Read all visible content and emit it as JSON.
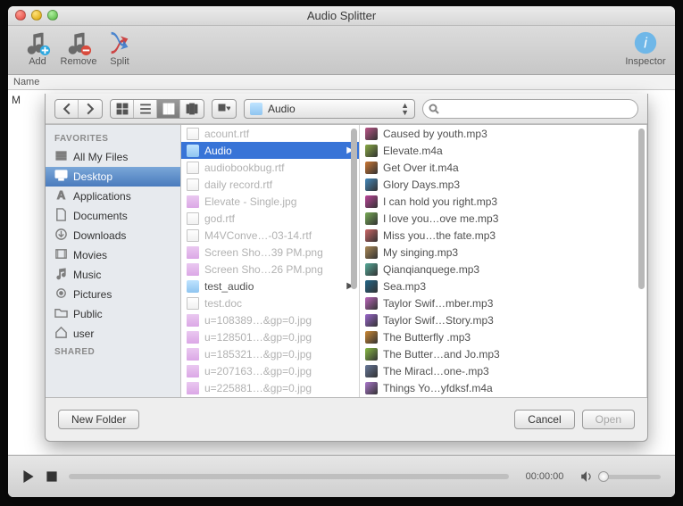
{
  "window": {
    "title": "Audio Splitter"
  },
  "toolbar": {
    "add": {
      "label": "Add"
    },
    "remove": {
      "label": "Remove"
    },
    "split": {
      "label": "Split"
    },
    "inspector": {
      "label": "Inspector"
    }
  },
  "column_header": "Name",
  "truncated_main_row": "M",
  "sheet": {
    "path_label": "Audio",
    "search_placeholder": "",
    "sidebar": {
      "favorites_header": "FAVORITES",
      "shared_header": "SHARED",
      "items": [
        {
          "label": "All My Files",
          "selected": false,
          "icon": "all-my-files-icon"
        },
        {
          "label": "Desktop",
          "selected": true,
          "icon": "desktop-icon"
        },
        {
          "label": "Applications",
          "selected": false,
          "icon": "applications-icon"
        },
        {
          "label": "Documents",
          "selected": false,
          "icon": "documents-icon"
        },
        {
          "label": "Downloads",
          "selected": false,
          "icon": "downloads-icon"
        },
        {
          "label": "Movies",
          "selected": false,
          "icon": "movies-icon"
        },
        {
          "label": "Music",
          "selected": false,
          "icon": "music-icon"
        },
        {
          "label": "Pictures",
          "selected": false,
          "icon": "pictures-icon"
        },
        {
          "label": "Public",
          "selected": false,
          "icon": "folder-icon"
        },
        {
          "label": "user",
          "selected": false,
          "icon": "home-icon"
        }
      ]
    },
    "col1": [
      {
        "label": "acount.rtf",
        "icon": "doc",
        "dimmed": true
      },
      {
        "label": "Audio",
        "icon": "folder",
        "dimmed": false,
        "selected": true,
        "hasChildren": true
      },
      {
        "label": "audiobookbug.rtf",
        "icon": "doc",
        "dimmed": true
      },
      {
        "label": "daily record.rtf",
        "icon": "doc",
        "dimmed": true
      },
      {
        "label": "Elevate - Single.jpg",
        "icon": "img",
        "dimmed": true
      },
      {
        "label": "god.rtf",
        "icon": "doc",
        "dimmed": true
      },
      {
        "label": "M4VConve…-03-14.rtf",
        "icon": "doc",
        "dimmed": true
      },
      {
        "label": "Screen Sho…39 PM.png",
        "icon": "img",
        "dimmed": true
      },
      {
        "label": "Screen Sho…26 PM.png",
        "icon": "img",
        "dimmed": true
      },
      {
        "label": "test_audio",
        "icon": "folder",
        "dimmed": false,
        "hasChildren": true
      },
      {
        "label": "test.doc",
        "icon": "doc",
        "dimmed": true
      },
      {
        "label": "u=108389…&gp=0.jpg",
        "icon": "img",
        "dimmed": true
      },
      {
        "label": "u=128501…&gp=0.jpg",
        "icon": "img",
        "dimmed": true
      },
      {
        "label": "u=185321…&gp=0.jpg",
        "icon": "img",
        "dimmed": true
      },
      {
        "label": "u=207163…&gp=0.jpg",
        "icon": "img",
        "dimmed": true
      },
      {
        "label": "u=225881…&gp=0.jpg",
        "icon": "img",
        "dimmed": true
      }
    ],
    "col2": [
      {
        "label": "Caused by youth.mp3"
      },
      {
        "label": "Elevate.m4a"
      },
      {
        "label": "Get Over it.m4a"
      },
      {
        "label": "Glory Days.mp3"
      },
      {
        "label": "I can hold you right.mp3"
      },
      {
        "label": "I love you…ove me.mp3"
      },
      {
        "label": "Miss you…the fate.mp3"
      },
      {
        "label": "My singing.mp3"
      },
      {
        "label": "Qianqianquege.mp3"
      },
      {
        "label": "Sea.mp3"
      },
      {
        "label": "Taylor Swif…mber.mp3"
      },
      {
        "label": "Taylor Swif…Story.mp3"
      },
      {
        "label": "The Butterfly .mp3"
      },
      {
        "label": "The Butter…and Jo.mp3"
      },
      {
        "label": "The Miracl…one-.mp3"
      },
      {
        "label": "Things Yo…yfdksf.m4a"
      }
    ],
    "buttons": {
      "new_folder": "New Folder",
      "cancel": "Cancel",
      "open": "Open"
    }
  },
  "player": {
    "time": "00:00:00"
  }
}
